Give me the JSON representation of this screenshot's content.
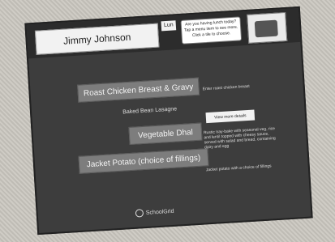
{
  "header": {
    "name": "Jimmy Johnson",
    "badge": "Lun",
    "speech": "Are you having lunch today? Tap a menu item to see more. Click a tile to choose.",
    "mascot": "mascot-icon"
  },
  "menu": {
    "items": [
      {
        "label": "Roast Chicken Breast & Gravy"
      },
      {
        "label": "Baked Bean Lasagne"
      },
      {
        "label": "Vegetable Dhal"
      },
      {
        "label": "Jacket Potato (choice of fillings)"
      }
    ]
  },
  "details": {
    "top_note": "Enter roast chicken breast",
    "desc_button": "View more details",
    "middle_note": "Rustic tray-bake with seasonal veg, rice and lentil topped with cheesy sauce, served with salad and bread, containing dairy and egg",
    "bottom_note": "Jacket potato with a choice of fillings"
  },
  "footer": {
    "brand": "SchoolGrid"
  }
}
